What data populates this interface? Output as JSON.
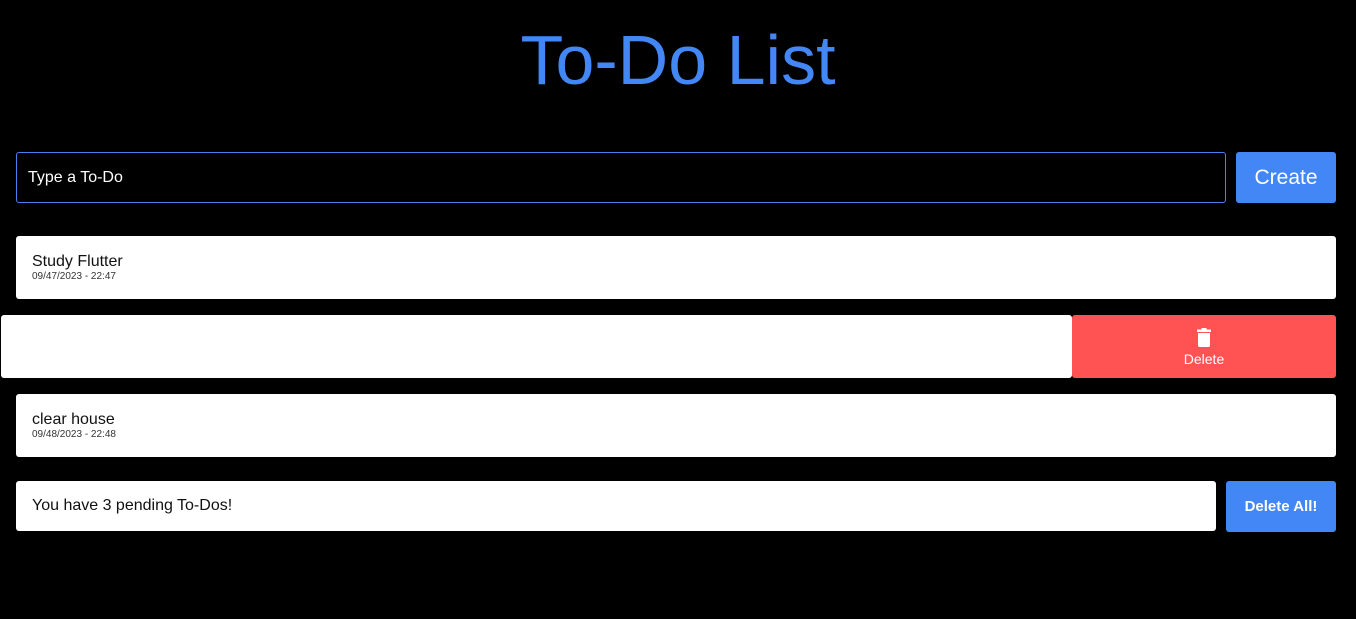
{
  "header": {
    "title": "To-Do List"
  },
  "new_todo": {
    "placeholder": "Type a To-Do",
    "value": "",
    "create_label": "Create"
  },
  "tasks": [
    {
      "title": "Study Flutter",
      "date": "09/47/2023 - 22:47"
    },
    {
      "title": "",
      "date": "",
      "swiped": true,
      "action_label": "Delete",
      "action_icon": "trash-icon"
    },
    {
      "title": "clear house",
      "date": "09/48/2023 - 22:48"
    }
  ],
  "footer": {
    "pending_text": "You have 3 pending To-Dos!",
    "delete_all_label": "Delete All!"
  },
  "colors": {
    "background": "#000000",
    "accent": "#4287f5",
    "danger": "#ff5252",
    "card": "#ffffff"
  }
}
